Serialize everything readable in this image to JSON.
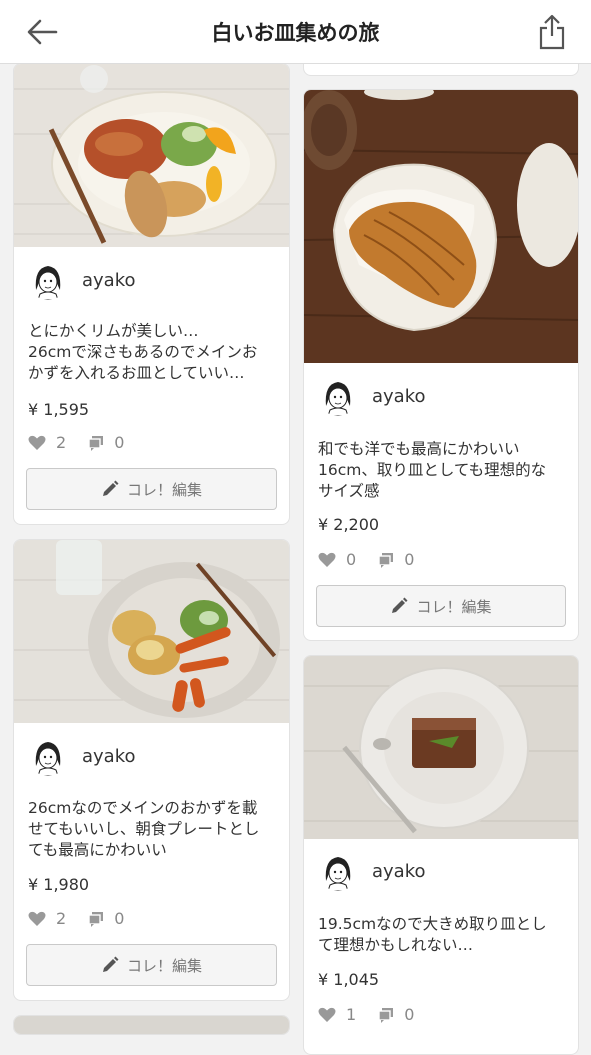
{
  "header": {
    "title": "白いお皿集めの旅",
    "back_icon": "arrow-left-icon",
    "share_icon": "share-icon"
  },
  "cards": [
    {
      "user": "ayako",
      "desc_line1": "とにかくリムが美しい…",
      "desc_line2": "26cmで深さもあるのでメインお",
      "desc_line3": "かずを入れるお皿としていい…",
      "price": "¥ 1,595",
      "likes": "2",
      "comments": "0",
      "button": "コレ！編集"
    },
    {
      "user": "ayako",
      "desc_line1": "和でも洋でも最高にかわいい",
      "desc_line2": "16cm、取り皿としても理想的な",
      "desc_line3": "サイズ感",
      "price": "¥ 2,200",
      "likes": "0",
      "comments": "0",
      "button": "コレ！編集"
    },
    {
      "user": "ayako",
      "desc_line1": "26cmなのでメインのおかずを載",
      "desc_line2": "せてもいいし、朝食プレートとし",
      "desc_line3": "ても最高にかわいい",
      "price": "¥ 1,980",
      "likes": "2",
      "comments": "0",
      "button": "コレ！編集"
    },
    {
      "user": "ayako",
      "desc_line1": "19.5cmなので大きめ取り皿とし",
      "desc_line2": "て理想かもしれない…",
      "price": "¥ 1,045",
      "likes": "1",
      "comments": "0"
    }
  ]
}
